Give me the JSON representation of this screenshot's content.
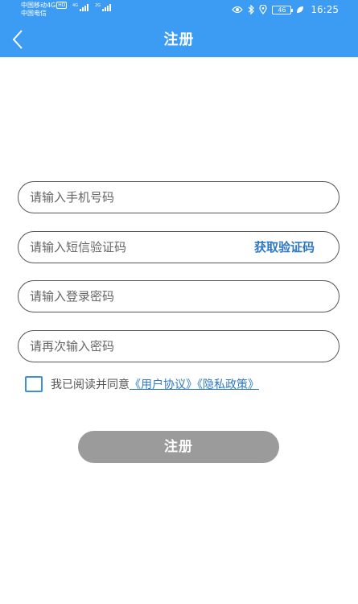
{
  "status_bar": {
    "carrier_1": "中国移动4G",
    "hd_badge": "HD",
    "carrier_2": "中国电信",
    "signal_1_label": "4G",
    "signal_2_label": "2G",
    "battery_level": "46",
    "time": "16:25"
  },
  "header": {
    "title": "注册"
  },
  "form": {
    "phone_placeholder": "请输入手机号码",
    "sms_code_placeholder": "请输入短信验证码",
    "get_code_label": "获取验证码",
    "password_placeholder": "请输入登录密码",
    "confirm_password_placeholder": "请再次输入密码"
  },
  "agreement": {
    "checked": false,
    "text": "我已阅读并同意",
    "user_agreement": "《用户协议》",
    "privacy_policy": "《隐私政策》"
  },
  "register_button": {
    "label": "注册"
  },
  "colors": {
    "primary": "#3c9bf2",
    "link": "#2e78c4",
    "button_disabled": "#9b9b9b"
  }
}
